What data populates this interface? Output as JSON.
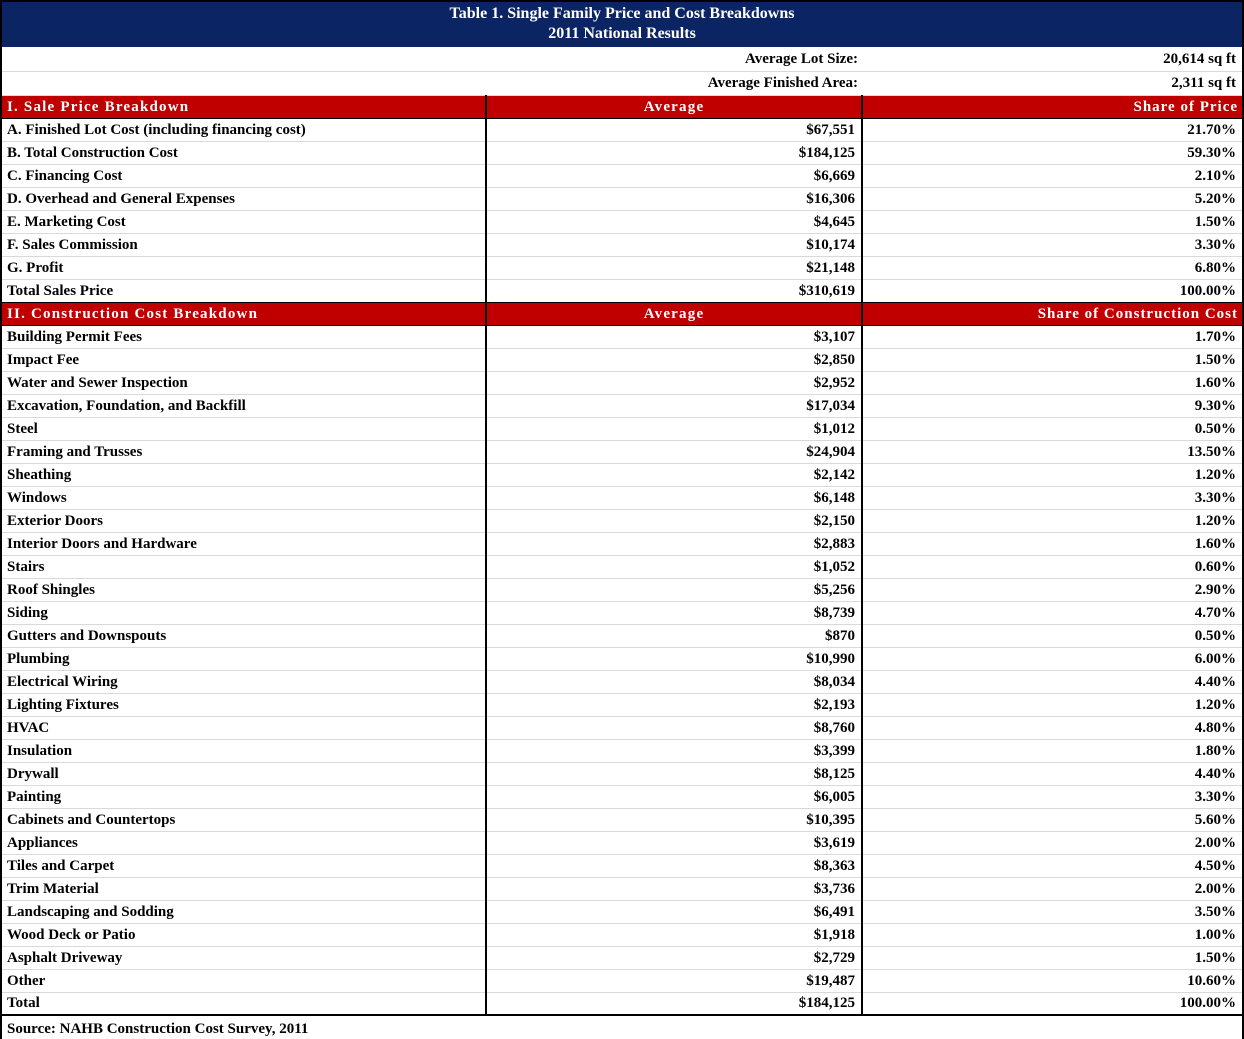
{
  "title": {
    "line1": "Table 1. Single Family Price and Cost Breakdowns",
    "line2": "2011 National Results"
  },
  "summary": [
    {
      "label": "Average Lot Size:",
      "value": "20,614 sq ft"
    },
    {
      "label": "Average Finished Area:",
      "value": "2,311 sq ft"
    }
  ],
  "section1": {
    "header": {
      "label": "I.  Sale Price Breakdown",
      "average": "Average",
      "share": "Share of Price"
    },
    "rows": [
      {
        "label": "A. Finished Lot Cost (including financing cost)",
        "average": "$67,551",
        "share": "21.70%"
      },
      {
        "label": "B. Total Construction Cost",
        "average": "$184,125",
        "share": "59.30%"
      },
      {
        "label": "C. Financing Cost",
        "average": "$6,669",
        "share": "2.10%"
      },
      {
        "label": "D. Overhead and General Expenses",
        "average": "$16,306",
        "share": "5.20%"
      },
      {
        "label": "E. Marketing Cost",
        "average": "$4,645",
        "share": "1.50%"
      },
      {
        "label": "F. Sales Commission",
        "average": "$10,174",
        "share": "3.30%"
      },
      {
        "label": "G. Profit",
        "average": "$21,148",
        "share": "6.80%"
      },
      {
        "label": "Total Sales Price",
        "average": "$310,619",
        "share": "100.00%"
      }
    ]
  },
  "section2": {
    "header": {
      "label": "II.  Construction Cost Breakdown",
      "average": "Average",
      "share": "Share of Construction Cost"
    },
    "rows": [
      {
        "label": "Building Permit Fees",
        "average": "$3,107",
        "share": "1.70%"
      },
      {
        "label": "Impact Fee",
        "average": "$2,850",
        "share": "1.50%"
      },
      {
        "label": "Water and Sewer Inspection",
        "average": "$2,952",
        "share": "1.60%"
      },
      {
        "label": "Excavation, Foundation, and Backfill",
        "average": "$17,034",
        "share": "9.30%"
      },
      {
        "label": "Steel",
        "average": "$1,012",
        "share": "0.50%"
      },
      {
        "label": "Framing and Trusses",
        "average": "$24,904",
        "share": "13.50%"
      },
      {
        "label": "Sheathing",
        "average": "$2,142",
        "share": "1.20%"
      },
      {
        "label": "Windows",
        "average": "$6,148",
        "share": "3.30%"
      },
      {
        "label": "Exterior Doors",
        "average": "$2,150",
        "share": "1.20%"
      },
      {
        "label": "Interior Doors and Hardware",
        "average": "$2,883",
        "share": "1.60%"
      },
      {
        "label": "Stairs",
        "average": "$1,052",
        "share": "0.60%"
      },
      {
        "label": "Roof Shingles",
        "average": "$5,256",
        "share": "2.90%"
      },
      {
        "label": "Siding",
        "average": "$8,739",
        "share": "4.70%"
      },
      {
        "label": "Gutters and Downspouts",
        "average": "$870",
        "share": "0.50%"
      },
      {
        "label": "Plumbing",
        "average": "$10,990",
        "share": "6.00%"
      },
      {
        "label": "Electrical Wiring",
        "average": "$8,034",
        "share": "4.40%"
      },
      {
        "label": "Lighting Fixtures",
        "average": "$2,193",
        "share": "1.20%"
      },
      {
        "label": "HVAC",
        "average": "$8,760",
        "share": "4.80%"
      },
      {
        "label": "Insulation",
        "average": "$3,399",
        "share": "1.80%"
      },
      {
        "label": "Drywall",
        "average": "$8,125",
        "share": "4.40%"
      },
      {
        "label": "Painting",
        "average": "$6,005",
        "share": "3.30%"
      },
      {
        "label": "Cabinets and Countertops",
        "average": "$10,395",
        "share": "5.60%"
      },
      {
        "label": "Appliances",
        "average": "$3,619",
        "share": "2.00%"
      },
      {
        "label": "Tiles and Carpet",
        "average": "$8,363",
        "share": "4.50%"
      },
      {
        "label": "Trim Material",
        "average": "$3,736",
        "share": "2.00%"
      },
      {
        "label": "Landscaping and Sodding",
        "average": "$6,491",
        "share": "3.50%"
      },
      {
        "label": "Wood Deck or Patio",
        "average": "$1,918",
        "share": "1.00%"
      },
      {
        "label": "Asphalt Driveway",
        "average": "$2,729",
        "share": "1.50%"
      },
      {
        "label": "Other",
        "average": "$19,487",
        "share": "10.60%"
      },
      {
        "label": "Total",
        "average": "$184,125",
        "share": "100.00%"
      }
    ]
  },
  "source": "Source: NAHB Construction Cost Survey, 2011",
  "colors": {
    "title_band": "#0B2464",
    "section_band": "#C00000",
    "row_separator": "#d9d9d9",
    "border": "#000000"
  }
}
